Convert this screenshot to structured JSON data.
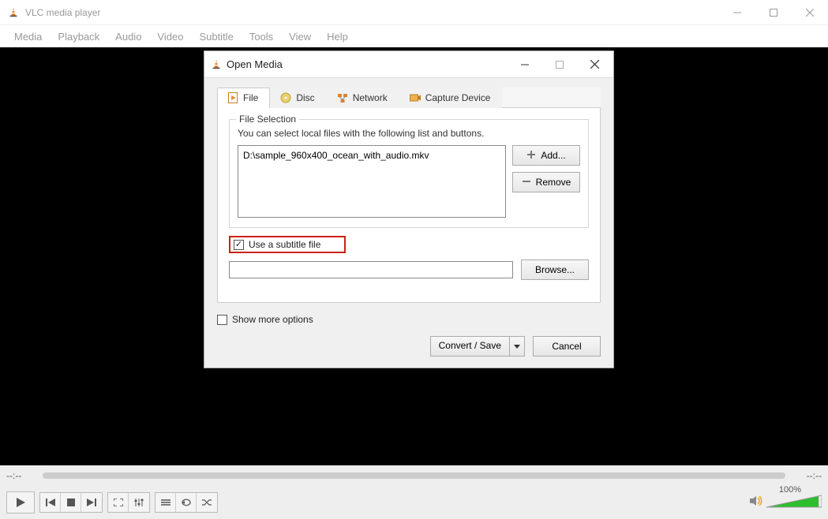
{
  "window": {
    "title": "VLC media player"
  },
  "menu": {
    "items": [
      "Media",
      "Playback",
      "Audio",
      "Video",
      "Subtitle",
      "Tools",
      "View",
      "Help"
    ]
  },
  "seek": {
    "left": "--:--",
    "right": "--:--"
  },
  "volume": {
    "label": "100%"
  },
  "dialog": {
    "title": "Open Media",
    "tabs": {
      "file": "File",
      "disc": "Disc",
      "network": "Network",
      "capture": "Capture Device"
    },
    "file_selection": {
      "legend": "File Selection",
      "hint": "You can select local files with the following list and buttons.",
      "files": [
        "D:\\sample_960x400_ocean_with_audio.mkv"
      ],
      "add": "Add...",
      "remove": "Remove"
    },
    "subtitle": {
      "label": "Use a subtitle file",
      "checked": true,
      "browse": "Browse...",
      "value": ""
    },
    "more_options": {
      "label": "Show more options",
      "checked": false
    },
    "buttons": {
      "convert": "Convert / Save",
      "cancel": "Cancel"
    }
  }
}
